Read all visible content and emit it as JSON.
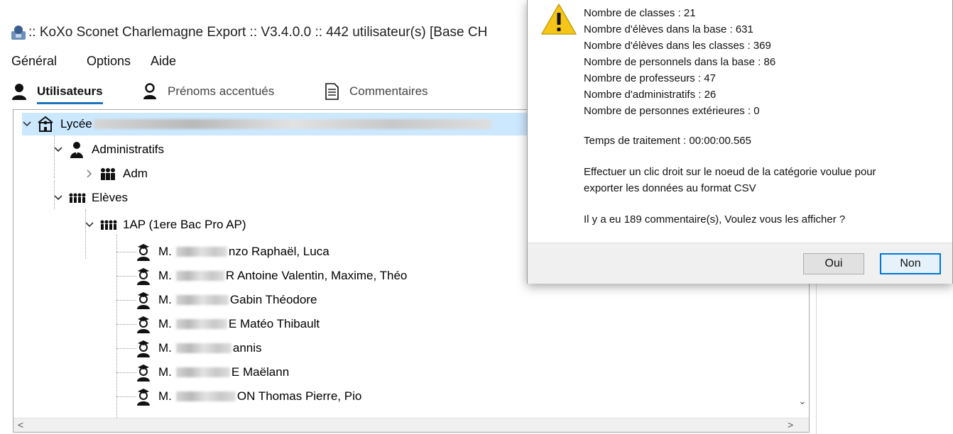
{
  "window": {
    "title": ":: KoXo Sconet Charlemagne Export :: V3.4.0.0 :: 442 utilisateur(s) [Base CH"
  },
  "menu": [
    "Général",
    "Options",
    "Aide"
  ],
  "tabs": [
    {
      "label": "Utilisateurs",
      "icon": "user-icon",
      "active": true
    },
    {
      "label": "Prénoms accentués",
      "icon": "user-outline-icon",
      "active": false
    },
    {
      "label": "Commentaires",
      "icon": "document-icon",
      "active": false
    }
  ],
  "tree": {
    "root": {
      "label": "Lycée",
      "icon": "school-icon"
    },
    "administratifs": {
      "label": "Administratifs",
      "icon": "admin-user-icon"
    },
    "adm": {
      "label": "Adm",
      "icon": "group-icon"
    },
    "eleves": {
      "label": "Elèves",
      "icon": "students-group-icon"
    },
    "class_1ap": {
      "label": "1AP (1ere Bac Pro AP)",
      "icon": "students-group-icon"
    },
    "students": [
      {
        "prefix": "M.",
        "visible": "nzo Raphaël, Luca"
      },
      {
        "prefix": "M.",
        "visible": "R Antoine Valentin, Maxime, Théo"
      },
      {
        "prefix": "M.",
        "visible": "Gabin Théodore"
      },
      {
        "prefix": "M.",
        "visible": "E Matéo Thibault"
      },
      {
        "prefix": "M.",
        "visible": "annis"
      },
      {
        "prefix": "M.",
        "visible": "E Maëlann"
      },
      {
        "prefix": "M.",
        "visible": "ON Thomas Pierre, Pio"
      }
    ]
  },
  "dialog": {
    "lines": [
      "Nombre de classes : 21",
      "Nombre d'élèves dans la base : 631",
      "Nombre d'élèves dans les classes : 369",
      "Nombre de personnels dans la base : 86",
      "Nombre de professeurs : 47",
      "Nombre d'administratifs : 26",
      "Nombre de personnes extérieures : 0"
    ],
    "time": "Temps de traitement : 00:00:00.565",
    "instruction_1": "Effectuer un clic droit sur le noeud de la catégorie voulue pour",
    "instruction_2": "exporter les données au format CSV",
    "question": "Il y a eu 189 commentaire(s), Voulez vous les afficher ?",
    "buttons": {
      "yes": "Oui",
      "no": "Non"
    }
  },
  "colors": {
    "accent": "#1e73be",
    "selection": "#cce8ff",
    "warning": "#f5c518",
    "default_button_border": "#0078d7"
  }
}
